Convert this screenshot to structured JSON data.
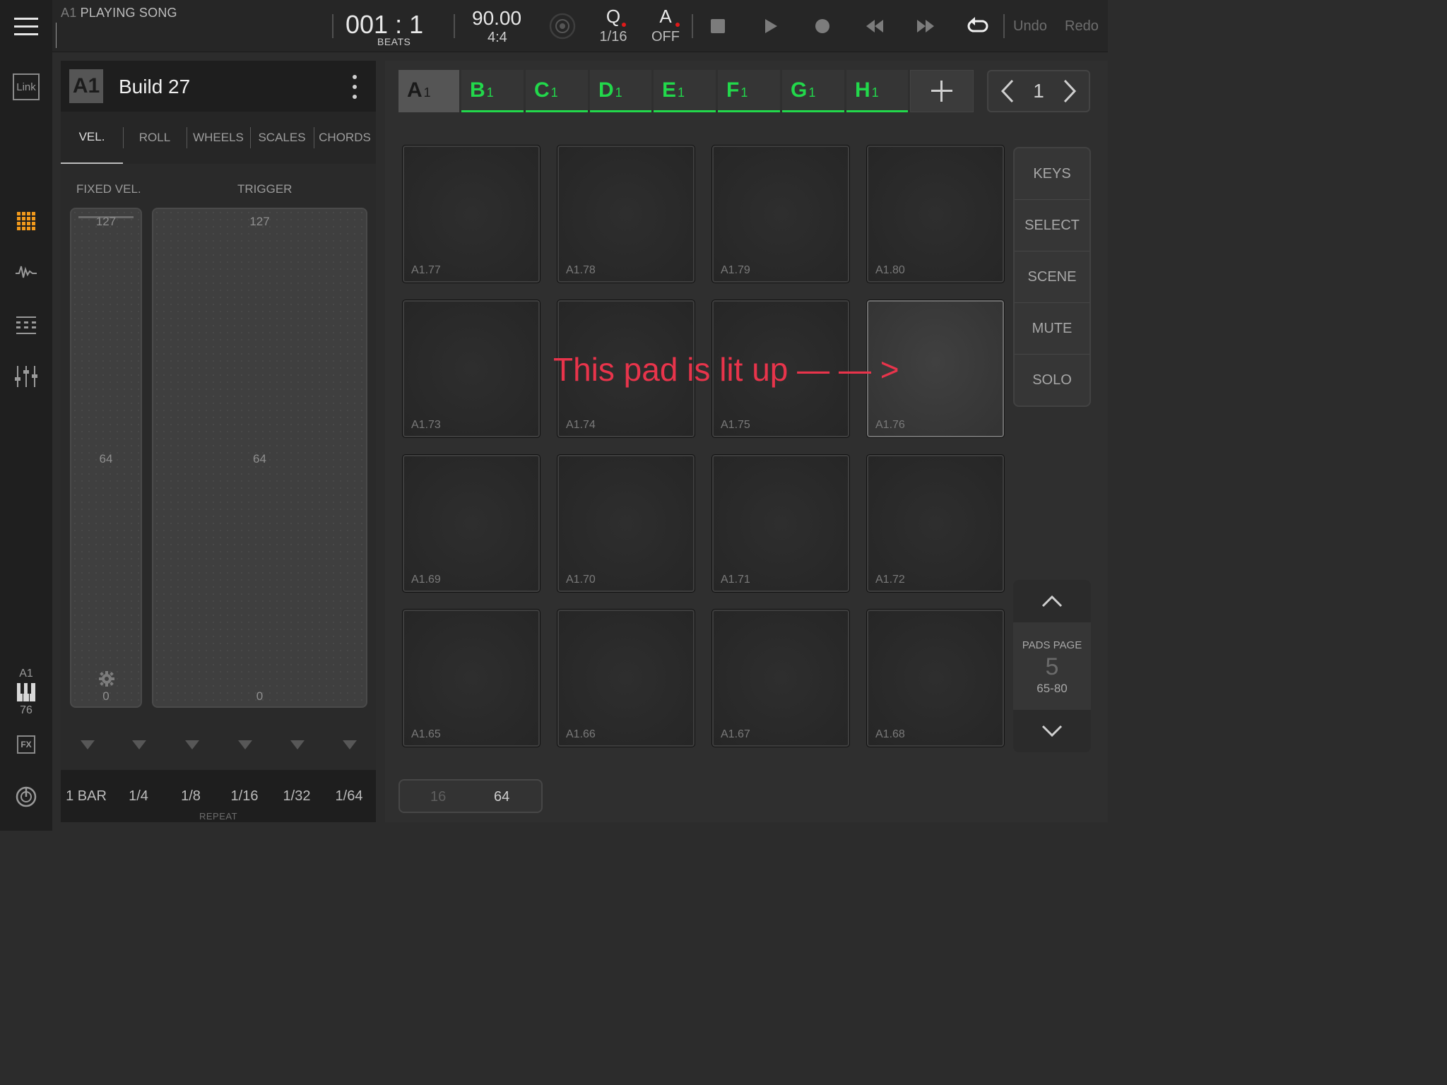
{
  "topbar": {
    "track_prefix": "A1",
    "song_status": "PLAYING SONG",
    "position": "001 : 1",
    "position_unit": "BEATS",
    "tempo": "90.00",
    "time_signature": "4:4",
    "quantize_label": "Q",
    "quantize_value": "1/16",
    "automation_label": "A",
    "automation_value": "OFF",
    "undo_label": "Undo",
    "redo_label": "Redo",
    "record_dot_color": "#e01a1a"
  },
  "rail": {
    "link_label": "Link",
    "active_color": "#f29a1c",
    "track_label": "A1",
    "track_number": "76",
    "fx_label": "FX",
    "icons": [
      "menu-icon",
      "link-icon",
      "pads-grid-icon",
      "waveform-icon",
      "sequencer-icon",
      "mixer-icon",
      "piano-keys-icon",
      "fx-icon",
      "metronome-icon"
    ]
  },
  "left_panel": {
    "track_badge": "A1",
    "track_name": "Build 27",
    "tabs": [
      "VEL.",
      "ROLL",
      "WHEELS",
      "SCALES",
      "CHORDS"
    ],
    "active_tab": "VEL.",
    "fixed_vel_label": "FIXED VEL.",
    "trigger_label": "TRIGGER",
    "fixed_strip": {
      "top": "127",
      "mid": "64",
      "bottom": "0"
    },
    "trigger_strip": {
      "top": "127",
      "mid": "64",
      "bottom": "0"
    },
    "repeat_options": [
      "1 BAR",
      "1/4",
      "1/8",
      "1/16",
      "1/32",
      "1/64"
    ],
    "repeat_label": "REPEAT"
  },
  "main": {
    "banks": [
      {
        "letter": "A",
        "num": "1",
        "selected": true
      },
      {
        "letter": "B",
        "num": "1",
        "selected": false
      },
      {
        "letter": "C",
        "num": "1",
        "selected": false
      },
      {
        "letter": "D",
        "num": "1",
        "selected": false
      },
      {
        "letter": "E",
        "num": "1",
        "selected": false
      },
      {
        "letter": "F",
        "num": "1",
        "selected": false
      },
      {
        "letter": "G",
        "num": "1",
        "selected": false
      },
      {
        "letter": "H",
        "num": "1",
        "selected": false
      }
    ],
    "bank_accent": "#22d84b",
    "bank_page": "1",
    "pads": [
      [
        "A1.77",
        "A1.78",
        "A1.79",
        "A1.80"
      ],
      [
        "A1.73",
        "A1.74",
        "A1.75",
        "A1.76"
      ],
      [
        "A1.69",
        "A1.70",
        "A1.71",
        "A1.72"
      ],
      [
        "A1.65",
        "A1.66",
        "A1.67",
        "A1.68"
      ]
    ],
    "lit_pad": "A1.76",
    "modes": [
      "KEYS",
      "SELECT",
      "SCENE",
      "MUTE",
      "SOLO"
    ],
    "pads_page_label": "PADS PAGE",
    "pads_page_number": "5",
    "pads_page_range": "65-80",
    "range_options": [
      "16",
      "64"
    ],
    "range_selected": "64",
    "annotation_text": "This pad is lit up — — >",
    "annotation_color": "#e8344b"
  }
}
